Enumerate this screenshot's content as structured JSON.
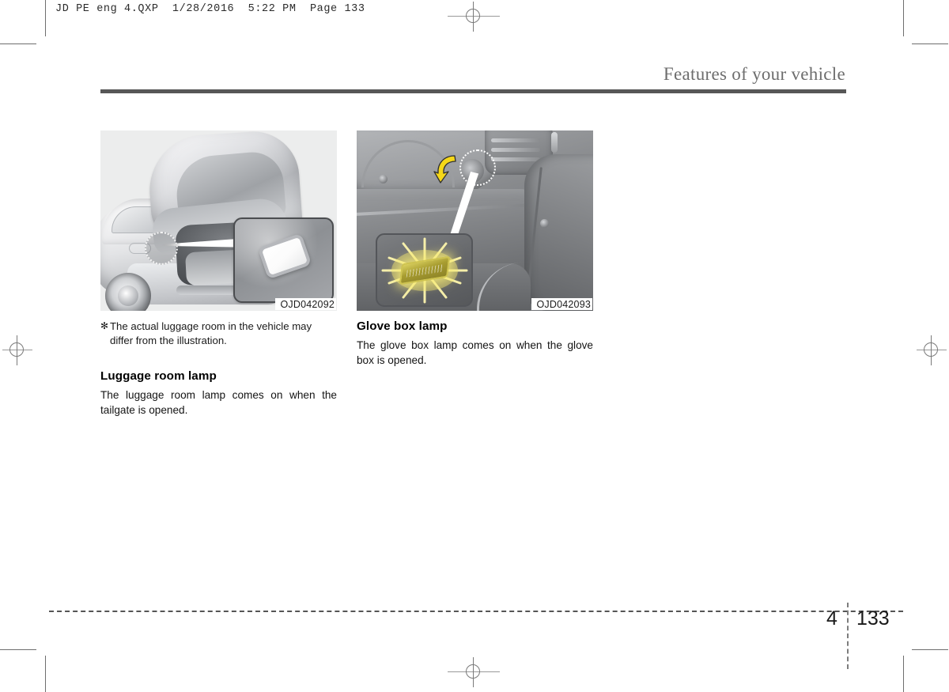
{
  "prepress": {
    "header_line": "JD PE eng 4.QXP  1/28/2016  5:22 PM  Page 133"
  },
  "running_head": {
    "title": "Features of your vehicle"
  },
  "columns": {
    "left": {
      "figure": {
        "caption_code": "OJD042092",
        "alt": "luggage-room-lamp-illustration"
      },
      "note": {
        "mark": "✻",
        "text": "The actual luggage room in the vehicle may differ from the illustration."
      },
      "section_title": "Luggage room lamp",
      "body_text": "The luggage room lamp comes on when the tailgate is opened."
    },
    "right": {
      "figure": {
        "caption_code": "OJD042093",
        "alt": "glove-box-lamp-illustration"
      },
      "section_title": "Glove box lamp",
      "body_text": "The glove box lamp comes on when the glove box is opened."
    }
  },
  "footer": {
    "chapter": "4",
    "page": "133"
  },
  "colors": {
    "rule": "#575757",
    "running_head_text": "#6d6d6d",
    "body_text": "#141414",
    "lamp_glow": "#f8ec78",
    "arrow": "#f5d718"
  }
}
